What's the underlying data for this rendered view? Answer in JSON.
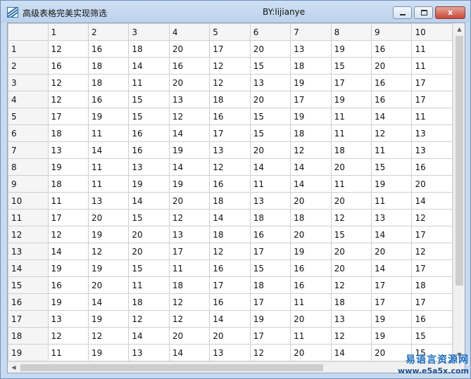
{
  "window": {
    "title": "高级表格完美实现筛选",
    "author": "BY:lijianye",
    "controls": {
      "minimize": "",
      "maximize": "",
      "close": "x"
    }
  },
  "grid": {
    "columns": [
      "",
      "1",
      "2",
      "3",
      "4",
      "5",
      "6",
      "7",
      "8",
      "9",
      "10"
    ],
    "rows": [
      {
        "label": "1",
        "values": [
          "12",
          "16",
          "18",
          "20",
          "17",
          "20",
          "13",
          "19",
          "16",
          "11"
        ]
      },
      {
        "label": "2",
        "values": [
          "16",
          "18",
          "14",
          "16",
          "12",
          "15",
          "18",
          "15",
          "20",
          "11"
        ]
      },
      {
        "label": "3",
        "values": [
          "12",
          "18",
          "11",
          "20",
          "12",
          "13",
          "19",
          "17",
          "16",
          "17"
        ]
      },
      {
        "label": "4",
        "values": [
          "12",
          "16",
          "15",
          "13",
          "18",
          "20",
          "17",
          "19",
          "16",
          "17"
        ]
      },
      {
        "label": "5",
        "values": [
          "17",
          "19",
          "15",
          "12",
          "16",
          "15",
          "19",
          "11",
          "14",
          "11"
        ]
      },
      {
        "label": "6",
        "values": [
          "18",
          "11",
          "16",
          "14",
          "17",
          "15",
          "18",
          "11",
          "12",
          "13"
        ]
      },
      {
        "label": "7",
        "values": [
          "13",
          "14",
          "16",
          "19",
          "13",
          "20",
          "12",
          "18",
          "11",
          "13"
        ]
      },
      {
        "label": "8",
        "values": [
          "19",
          "11",
          "13",
          "14",
          "12",
          "14",
          "14",
          "20",
          "15",
          "16"
        ]
      },
      {
        "label": "9",
        "values": [
          "18",
          "11",
          "19",
          "19",
          "16",
          "11",
          "14",
          "11",
          "19",
          "20"
        ]
      },
      {
        "label": "10",
        "values": [
          "11",
          "13",
          "14",
          "20",
          "18",
          "13",
          "20",
          "20",
          "11",
          "14"
        ]
      },
      {
        "label": "11",
        "values": [
          "17",
          "20",
          "15",
          "12",
          "14",
          "18",
          "18",
          "12",
          "13",
          "12"
        ]
      },
      {
        "label": "12",
        "values": [
          "12",
          "19",
          "20",
          "13",
          "18",
          "16",
          "20",
          "15",
          "14",
          "17"
        ]
      },
      {
        "label": "13",
        "values": [
          "14",
          "12",
          "20",
          "17",
          "12",
          "17",
          "19",
          "20",
          "20",
          "12"
        ]
      },
      {
        "label": "14",
        "values": [
          "19",
          "19",
          "15",
          "11",
          "16",
          "15",
          "16",
          "20",
          "14",
          "17"
        ]
      },
      {
        "label": "15",
        "values": [
          "16",
          "20",
          "11",
          "18",
          "17",
          "18",
          "16",
          "12",
          "17",
          "18"
        ]
      },
      {
        "label": "16",
        "values": [
          "19",
          "14",
          "18",
          "12",
          "16",
          "17",
          "11",
          "18",
          "17",
          "17"
        ]
      },
      {
        "label": "17",
        "values": [
          "13",
          "19",
          "12",
          "12",
          "14",
          "19",
          "20",
          "13",
          "19",
          "16"
        ]
      },
      {
        "label": "18",
        "values": [
          "12",
          "12",
          "14",
          "20",
          "20",
          "17",
          "11",
          "12",
          "19",
          "15"
        ]
      },
      {
        "label": "19",
        "values": [
          "11",
          "19",
          "13",
          "14",
          "13",
          "12",
          "20",
          "14",
          "20",
          "15"
        ]
      }
    ]
  },
  "scrollbars": {
    "up": "▲",
    "down": "▼",
    "left": "◀"
  },
  "watermark": {
    "site_name": "易语言资源网",
    "url": "www.e5a5x.com"
  }
}
